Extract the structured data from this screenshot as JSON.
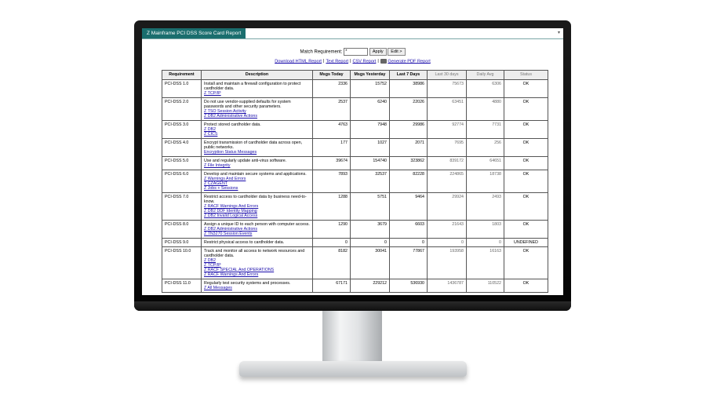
{
  "window": {
    "title": "Z Mainframe PCI DSS Score Card Report"
  },
  "filter": {
    "label": "Match Requirement:",
    "value": "*",
    "apply_label": "Apply",
    "edit_label": "Edit >"
  },
  "links": [
    "Download HTML Report",
    "Text Report",
    "CSV Report",
    "Generate PDF Report"
  ],
  "table": {
    "headers": [
      "Requirement",
      "Description",
      "Msgs Today",
      "Msgs Yesterday",
      "Last 7 Days",
      "Last 30 days",
      "Daily Avg",
      "Status"
    ],
    "rows": [
      {
        "req": "PCI-DSS 1.0",
        "desc": "Install and maintain a firewall configuration to protect cardholder data.",
        "links": [
          "Z TCP/IP"
        ],
        "today": "2336",
        "yesterday": "15752",
        "last7": "38986",
        "last30": "75673",
        "avg": "6306",
        "status": "OK"
      },
      {
        "req": "PCI-DSS 2.0",
        "desc": "Do not use vendor-supplied defaults for system passwords and other security parameters.",
        "links": [
          "Z TSO Session Activity",
          "Z DB2 Administrative Actions"
        ],
        "today": "2537",
        "yesterday": "6240",
        "last7": "22026",
        "last30": "63451",
        "avg": "4880",
        "status": "OK"
      },
      {
        "req": "PCI-DSS 3.0",
        "desc": "Protect stored cardholder data.",
        "links": [
          "Z DB2",
          "Z CICS"
        ],
        "today": "4763",
        "yesterday": "7948",
        "last7": "29986",
        "last30": "92774",
        "avg": "7731",
        "status": "OK"
      },
      {
        "req": "PCI-DSS 4.0",
        "desc": "Encrypt transmission of cardholder data across open, public networks.",
        "links": [
          "Encryption Status Messages"
        ],
        "today": "177",
        "yesterday": "1027",
        "last7": "2071",
        "last30": "7695",
        "avg": "256",
        "status": "OK"
      },
      {
        "req": "PCI-DSS 5.0",
        "desc": "Use and regularly update anti-virus software.",
        "links": [
          "Z File Integrity"
        ],
        "today": "39674",
        "yesterday": "154740",
        "last7": "323862",
        "last30": "839172",
        "avg": "64651",
        "status": "OK"
      },
      {
        "req": "PCI-DSS 6.0",
        "desc": "Develop and maintain secure systems and applications.",
        "links": [
          "Z Warnings And Errors",
          "Z CZAGENT",
          "Z Jobs + Sessions"
        ],
        "today": "7893",
        "yesterday": "32537",
        "last7": "82228",
        "last30": "224865",
        "avg": "18738",
        "status": "OK"
      },
      {
        "req": "PCI-DSS 7.0",
        "desc": "Restrict access to cardholder data by business need-to-know.",
        "links": [
          "Z RACF Warnings And Errors",
          "Z DB2 DDF Identity Mapping",
          "Z DB2 Invalid Logical Access"
        ],
        "today": "1288",
        "yesterday": "5751",
        "last7": "9464",
        "last30": "29924",
        "avg": "2493",
        "status": "OK"
      },
      {
        "req": "PCI-DSS 8.0",
        "desc": "Assign a unique ID to each person with computer access.",
        "links": [
          "Z DB2 Administrative Actions",
          "Z TN3270 Session Events"
        ],
        "today": "1290",
        "yesterday": "3679",
        "last7": "6603",
        "last30": "21643",
        "avg": "1803",
        "status": "OK"
      },
      {
        "req": "PCI-DSS 9.0",
        "desc": "Restrict physical access to cardholder data.",
        "links": [],
        "today": "0",
        "yesterday": "0",
        "last7": "0",
        "last30": "0",
        "avg": "0",
        "status": "UNDEFINED"
      },
      {
        "req": "PCI-DSS 10.0",
        "desc": "Track and monitor all access to network resources and cardholder data.",
        "links": [
          "Z DB2",
          "Z TCP/IP",
          "Z RACF SPECIAL And OPERATIONS",
          "Z RACF Warnings And Errors"
        ],
        "today": "8182",
        "yesterday": "30041",
        "last7": "77867",
        "last30": "193958",
        "avg": "16163",
        "status": "OK"
      },
      {
        "req": "PCI-DSS 11.0",
        "desc": "Regularly test security systems and processes.",
        "links": [
          "Z All Messages"
        ],
        "today": "67171",
        "yesterday": "229212",
        "last7": "536930",
        "last30": "1436787",
        "avg": "110522",
        "status": "OK"
      }
    ]
  }
}
